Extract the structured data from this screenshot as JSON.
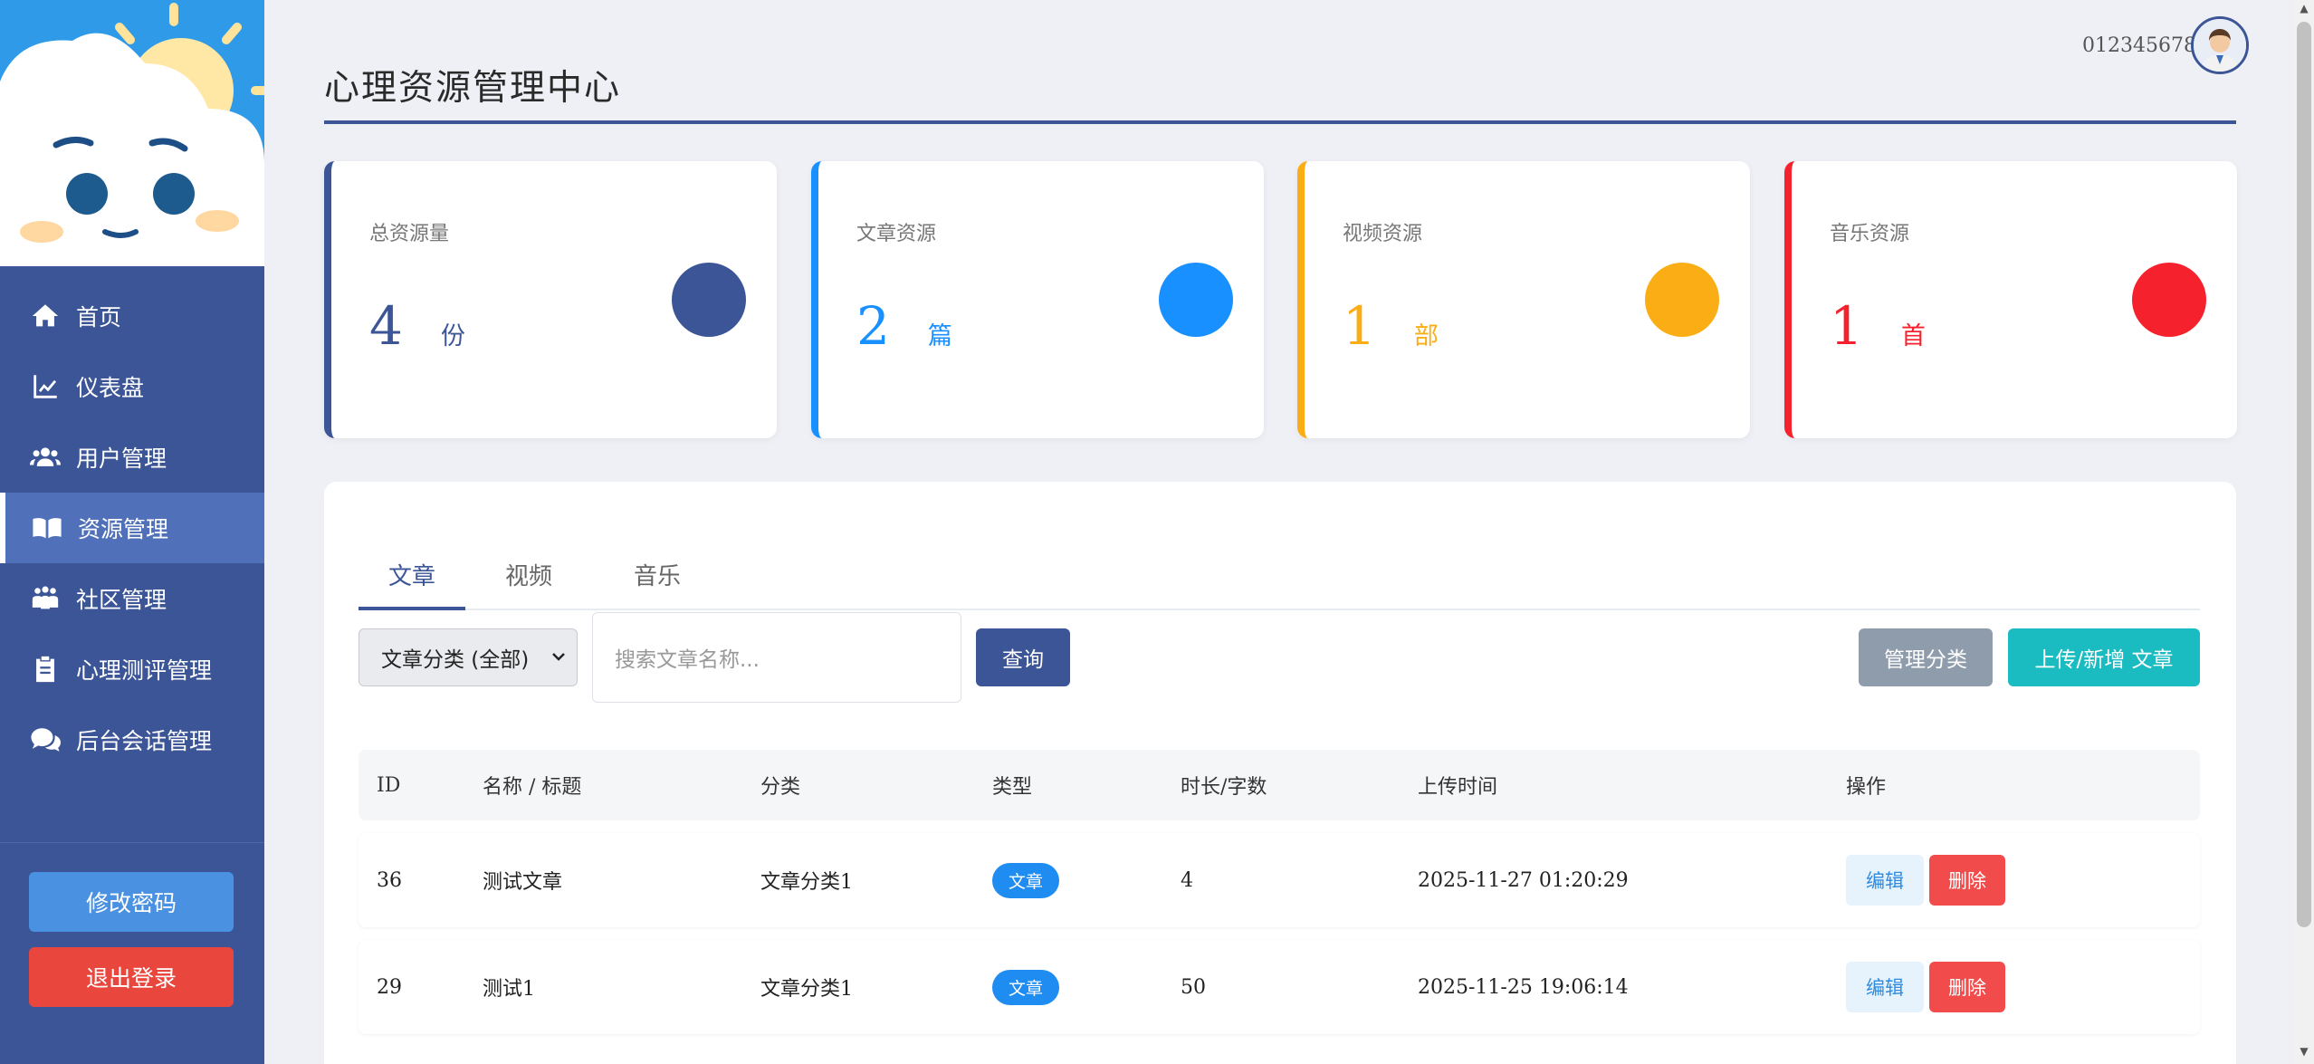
{
  "sidebar": {
    "items": [
      {
        "label": "首页",
        "icon": "home-icon"
      },
      {
        "label": "仪表盘",
        "icon": "chart-line-icon"
      },
      {
        "label": "用户管理",
        "icon": "users-icon"
      },
      {
        "label": "资源管理",
        "icon": "book-icon",
        "active": true
      },
      {
        "label": "社区管理",
        "icon": "community-icon"
      },
      {
        "label": "心理测评管理",
        "icon": "clipboard-icon"
      },
      {
        "label": "后台会话管理",
        "icon": "comments-icon"
      }
    ],
    "change_password": "修改密码",
    "logout": "退出登录"
  },
  "header": {
    "title": "心理资源管理中心",
    "user_id": "012345678"
  },
  "stats": [
    {
      "label": "总资源量",
      "value": "4",
      "unit": "份",
      "color": "#3b5597"
    },
    {
      "label": "文章资源",
      "value": "2",
      "unit": "篇",
      "color": "#1890ff"
    },
    {
      "label": "视频资源",
      "value": "1",
      "unit": "部",
      "color": "#faad14"
    },
    {
      "label": "音乐资源",
      "value": "1",
      "unit": "首",
      "color": "#f5222d"
    }
  ],
  "tabs": [
    "文章",
    "视频",
    "音乐"
  ],
  "toolbar": {
    "category_select": "文章分类 (全部)",
    "search_placeholder": "搜索文章名称...",
    "query": "查询",
    "manage_category": "管理分类",
    "upload": "上传/新增 文章"
  },
  "table": {
    "headers": [
      "ID",
      "名称 / 标题",
      "分类",
      "类型",
      "时长/字数",
      "上传时间",
      "操作"
    ],
    "rows": [
      {
        "id": "36",
        "name": "测试文章",
        "category": "文章分类1",
        "type": "文章",
        "length": "4",
        "time": "2025-11-27 01:20:29",
        "edit": "编辑",
        "delete": "删除"
      },
      {
        "id": "29",
        "name": "测试1",
        "category": "文章分类1",
        "type": "文章",
        "length": "50",
        "time": "2025-11-25 19:06:14",
        "edit": "编辑",
        "delete": "删除"
      }
    ]
  }
}
